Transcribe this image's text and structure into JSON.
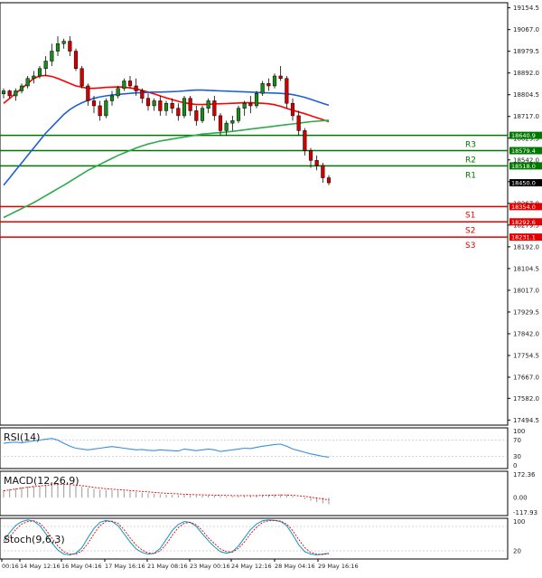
{
  "chart_data": {
    "type": "candlestick",
    "price_axis": {
      "ticks": [
        "19154.5",
        "19067.0",
        "18979.5",
        "18892.0",
        "18804.5",
        "18717.0",
        "18629.5",
        "18542.0",
        "18454.5",
        "18367.0",
        "18279.5",
        "18192.0",
        "18104.5",
        "18017.0",
        "17929.5",
        "17842.0",
        "17754.5",
        "17667.0",
        "17582.0",
        "17494.5"
      ],
      "range": [
        17474,
        19175
      ]
    },
    "time_axis": {
      "labels": [
        "00:16",
        "14 May 12:16",
        "16 May 04:16",
        "17 May 16:16",
        "21 May 08:16",
        "23 May 00:16",
        "24 May 12:16",
        "28 May 04:16",
        "29 May 16:16"
      ]
    },
    "candles": [
      [
        18808,
        18830,
        18790,
        18820
      ],
      [
        18820,
        18825,
        18790,
        18800
      ],
      [
        18800,
        18830,
        18780,
        18820
      ],
      [
        18820,
        18850,
        18810,
        18840
      ],
      [
        18840,
        18880,
        18830,
        18870
      ],
      [
        18870,
        18900,
        18850,
        18880
      ],
      [
        18880,
        18920,
        18870,
        18910
      ],
      [
        18910,
        18960,
        18880,
        18940
      ],
      [
        18940,
        19010,
        18920,
        18980
      ],
      [
        18980,
        19040,
        18960,
        19010
      ],
      [
        19010,
        19030,
        18990,
        19020
      ],
      [
        19020,
        19040,
        18960,
        18980
      ],
      [
        18980,
        18990,
        18900,
        18910
      ],
      [
        18910,
        18920,
        18830,
        18840
      ],
      [
        18840,
        18850,
        18760,
        18780
      ],
      [
        18780,
        18800,
        18730,
        18760
      ],
      [
        18760,
        18780,
        18700,
        18720
      ],
      [
        18720,
        18790,
        18710,
        18780
      ],
      [
        18780,
        18820,
        18760,
        18800
      ],
      [
        18800,
        18840,
        18790,
        18830
      ],
      [
        18830,
        18870,
        18820,
        18860
      ],
      [
        18860,
        18880,
        18830,
        18840
      ],
      [
        18840,
        18870,
        18800,
        18820
      ],
      [
        18820,
        18830,
        18770,
        18790
      ],
      [
        18790,
        18810,
        18740,
        18760
      ],
      [
        18760,
        18790,
        18740,
        18780
      ],
      [
        18780,
        18800,
        18720,
        18740
      ],
      [
        18740,
        18780,
        18720,
        18770
      ],
      [
        18770,
        18790,
        18730,
        18750
      ],
      [
        18750,
        18770,
        18700,
        18720
      ],
      [
        18720,
        18800,
        18710,
        18790
      ],
      [
        18790,
        18800,
        18720,
        18740
      ],
      [
        18740,
        18760,
        18680,
        18700
      ],
      [
        18700,
        18760,
        18690,
        18750
      ],
      [
        18750,
        18790,
        18730,
        18780
      ],
      [
        18780,
        18800,
        18700,
        18720
      ],
      [
        18720,
        18730,
        18640,
        18660
      ],
      [
        18660,
        18700,
        18640,
        18690
      ],
      [
        18690,
        18720,
        18660,
        18700
      ],
      [
        18700,
        18760,
        18690,
        18750
      ],
      [
        18750,
        18780,
        18720,
        18770
      ],
      [
        18770,
        18800,
        18730,
        18760
      ],
      [
        18760,
        18820,
        18750,
        18810
      ],
      [
        18810,
        18860,
        18800,
        18850
      ],
      [
        18850,
        18870,
        18820,
        18840
      ],
      [
        18840,
        18890,
        18830,
        18880
      ],
      [
        18880,
        18920,
        18860,
        18870
      ],
      [
        18870,
        18880,
        18750,
        18770
      ],
      [
        18770,
        18790,
        18700,
        18720
      ],
      [
        18720,
        18740,
        18640,
        18660
      ],
      [
        18660,
        18670,
        18560,
        18580
      ],
      [
        18580,
        18590,
        18510,
        18540
      ],
      [
        18540,
        18560,
        18500,
        18520
      ],
      [
        18520,
        18530,
        18450,
        18470
      ],
      [
        18470,
        18480,
        18440,
        18450
      ]
    ],
    "moving_averages": [
      {
        "color": "#ff0000",
        "values": [
          18770,
          18790,
          18810,
          18830,
          18850,
          18870,
          18880,
          18882,
          18878,
          18870,
          18860,
          18850,
          18840,
          18835,
          18830,
          18830,
          18832,
          18834,
          18835,
          18836,
          18835,
          18832,
          18828,
          18822,
          18815,
          18808,
          18800,
          18792,
          18785,
          18778,
          18772,
          18768,
          18765,
          18765,
          18766,
          18767,
          18768,
          18769,
          18770,
          18771,
          18772,
          18772,
          18771,
          18770,
          18768,
          18764,
          18758,
          18750,
          18742,
          18735,
          18728,
          18720,
          18712,
          18704,
          18696
        ]
      },
      {
        "color": "#1e5fd6",
        "values": [
          18440,
          18470,
          18500,
          18530,
          18560,
          18590,
          18620,
          18650,
          18675,
          18700,
          18725,
          18745,
          18760,
          18772,
          18782,
          18790,
          18796,
          18800,
          18803,
          18806,
          18808,
          18810,
          18812,
          18813,
          18814,
          18815,
          18815,
          18816,
          18817,
          18818,
          18820,
          18822,
          18823,
          18823,
          18822,
          18821,
          18820,
          18819,
          18818,
          18817,
          18816,
          18815,
          18814,
          18813,
          18812,
          18811,
          18810,
          18808,
          18805,
          18800,
          18794,
          18786,
          18778,
          18770,
          18762
        ]
      },
      {
        "color": "#2eaa4a",
        "values": [
          18310,
          18322,
          18334,
          18346,
          18358,
          18370,
          18384,
          18398,
          18412,
          18426,
          18440,
          18455,
          18470,
          18485,
          18500,
          18512,
          18524,
          18536,
          18548,
          18560,
          18570,
          18580,
          18590,
          18598,
          18606,
          18612,
          18618,
          18622,
          18626,
          18630,
          18634,
          18638,
          18642,
          18646,
          18648,
          18650,
          18652,
          18654,
          18657,
          18660,
          18663,
          18666,
          18669,
          18672,
          18675,
          18678,
          18681,
          18684,
          18687,
          18690,
          18693,
          18696,
          18698,
          18700,
          18702
        ]
      }
    ],
    "levels": [
      {
        "value": 18640.9,
        "value_text": "18640.9",
        "label": "R3",
        "color": "#007800"
      },
      {
        "value": 18579.4,
        "value_text": "18579.4",
        "label": "R2",
        "color": "#007800"
      },
      {
        "value": 18518.0,
        "value_text": "18518.0",
        "label": "R1",
        "color": "#007800"
      },
      {
        "value": 18354.0,
        "value_text": "18354.0",
        "label": "S1",
        "color": "#e00000"
      },
      {
        "value": 18292.6,
        "value_text": "18292.6",
        "label": "S2",
        "color": "#e00000"
      },
      {
        "value": 18231.1,
        "value_text": "18231.1",
        "label": "S3",
        "color": "#e00000"
      }
    ],
    "current_price": {
      "value": 18450.0,
      "text": "18450.0"
    },
    "indicators": {
      "rsi": {
        "name": "RSI(14)",
        "ticks": [
          "100",
          "70",
          "30",
          "0"
        ],
        "range": [
          0,
          100
        ],
        "color": "#3b8fe0",
        "values": [
          62,
          64,
          65,
          63,
          66,
          68,
          70,
          72,
          74,
          70,
          62,
          55,
          50,
          48,
          46,
          48,
          50,
          52,
          54,
          52,
          50,
          48,
          46,
          47,
          45,
          44,
          46,
          45,
          44,
          43,
          48,
          46,
          44,
          46,
          48,
          46,
          42,
          44,
          46,
          48,
          50,
          49,
          52,
          55,
          57,
          59,
          60,
          55,
          48,
          44,
          40,
          36,
          33,
          30,
          28
        ]
      },
      "macd": {
        "name": "MACD(12,26,9)",
        "ticks": [
          "172.36",
          "0.00",
          "-117.93"
        ],
        "range": [
          -117.93,
          172.36
        ],
        "histogram_color": "#999999",
        "signal_color": "#e00000",
        "histogram": [
          50,
          56,
          62,
          68,
          72,
          76,
          80,
          84,
          88,
          90,
          88,
          84,
          78,
          70,
          62,
          56,
          52,
          50,
          48,
          46,
          44,
          40,
          36,
          32,
          28,
          24,
          22,
          20,
          18,
          16,
          17,
          16,
          14,
          13,
          14,
          13,
          10,
          9,
          9,
          10,
          12,
          12,
          14,
          16,
          18,
          20,
          22,
          18,
          10,
          0,
          -10,
          -20,
          -30,
          -38,
          -44
        ],
        "signal": [
          45,
          50,
          56,
          62,
          68,
          72,
          76,
          80,
          84,
          86,
          86,
          85,
          82,
          78,
          73,
          67,
          62,
          58,
          55,
          52,
          49,
          46,
          43,
          40,
          37,
          34,
          31,
          28,
          26,
          24,
          22,
          20,
          19,
          18,
          17,
          16,
          15,
          14,
          13,
          13,
          13,
          13,
          13,
          14,
          15,
          16,
          17,
          17,
          15,
          12,
          8,
          3,
          -3,
          -9,
          -15
        ]
      },
      "stoch": {
        "name": "Stoch(9,6,3)",
        "ticks": [
          "100",
          "20"
        ],
        "range": [
          0,
          100
        ],
        "k_color": "#1e9cc8",
        "d_color": "#e00000",
        "k": [
          45,
          65,
          82,
          92,
          96,
          93,
          82,
          62,
          40,
          22,
          12,
          10,
          14,
          28,
          52,
          75,
          90,
          95,
          92,
          82,
          62,
          42,
          25,
          16,
          12,
          14,
          26,
          48,
          70,
          85,
          92,
          90,
          80,
          62,
          45,
          30,
          18,
          14,
          18,
          32,
          52,
          72,
          86,
          94,
          96,
          95,
          92,
          82,
          60,
          35,
          18,
          12,
          10,
          12,
          14
        ],
        "d": [
          40,
          55,
          72,
          86,
          92,
          94,
          88,
          72,
          52,
          32,
          18,
          12,
          12,
          20,
          38,
          62,
          82,
          92,
          93,
          88,
          72,
          52,
          34,
          22,
          15,
          13,
          20,
          36,
          58,
          77,
          88,
          90,
          84,
          70,
          52,
          38,
          25,
          18,
          17,
          26,
          42,
          62,
          78,
          90,
          94,
          95,
          93,
          86,
          70,
          48,
          28,
          16,
          12,
          11,
          13
        ]
      }
    }
  }
}
